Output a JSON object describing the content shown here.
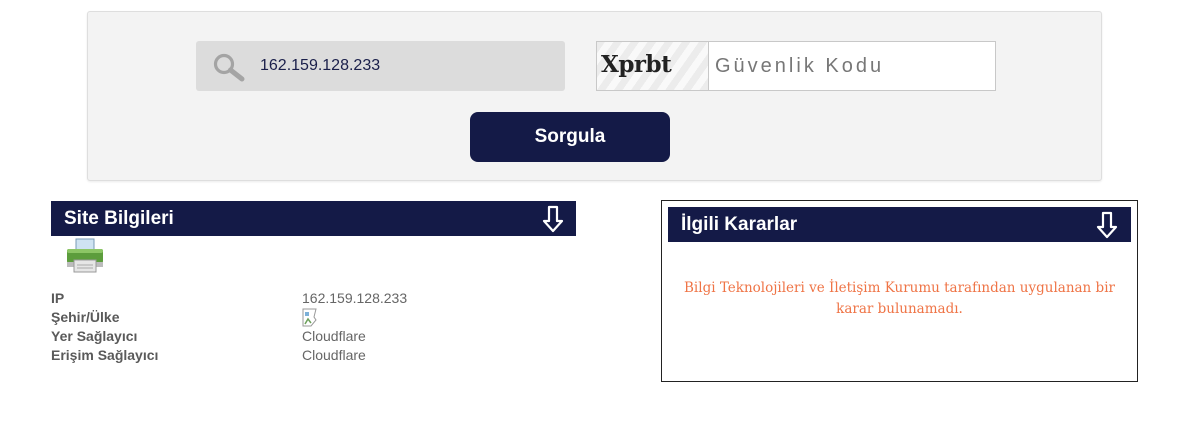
{
  "search": {
    "ip_value": "162.159.128.233"
  },
  "captcha": {
    "image_text": "Xprbt",
    "placeholder": "Güvenlik Kodu"
  },
  "submit_label": "Sorgula",
  "site_info": {
    "title": "Site Bilgileri",
    "rows": [
      {
        "label": "IP",
        "value": "162.159.128.233"
      },
      {
        "label": "Şehir/Ülke",
        "value": ""
      },
      {
        "label": "Yer Sağlayıcı",
        "value": "Cloudflare"
      },
      {
        "label": "Erişim Sağlayıcı",
        "value": "Cloudflare"
      }
    ]
  },
  "decisions": {
    "title": "İlgili Kararlar",
    "message_line1": "Bilgi Teknolojileri ve İletişim Kurumu tarafından uygulanan bir",
    "message_line2": "karar bulunamadı."
  },
  "colors": {
    "navy": "#141a47",
    "message": "#ef7446",
    "panel": "#f3f3f3"
  }
}
